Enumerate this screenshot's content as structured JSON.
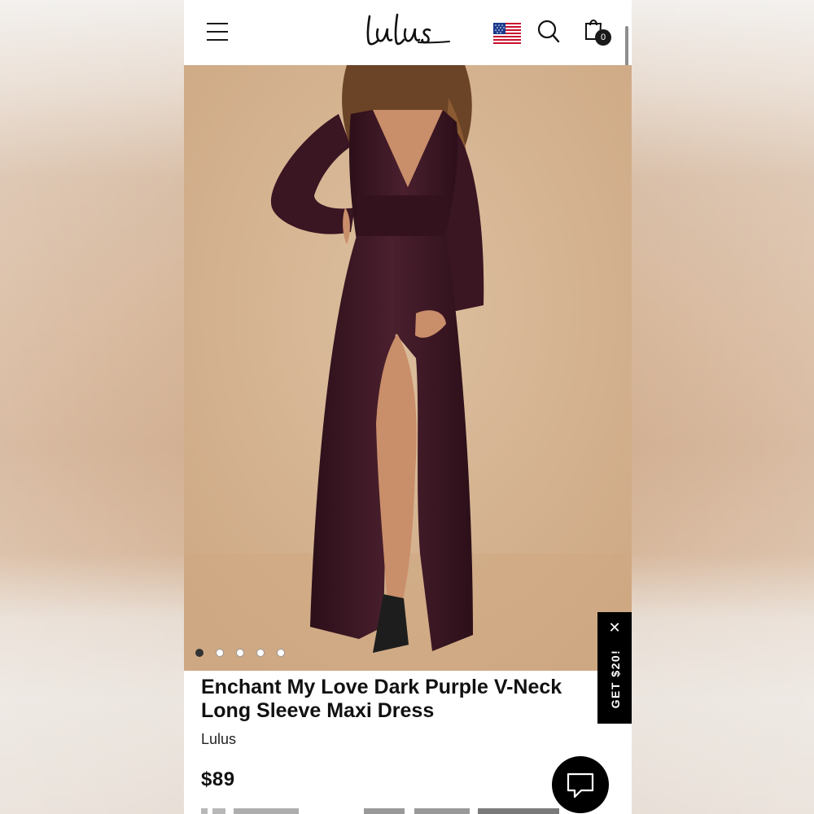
{
  "header": {
    "menu_icon": "hamburger-menu-icon",
    "logo_text": "Lulus",
    "flag_icon": "us-flag-icon",
    "search_icon": "search-icon",
    "cart_icon": "shopping-bag-icon",
    "cart_count": "0"
  },
  "gallery": {
    "image": "dark-purple-long-sleeve-maxi-dress-photo",
    "dots_total": 5,
    "active_dot": 1
  },
  "promo": {
    "label": "GET $20!",
    "close_icon": "close-icon"
  },
  "product": {
    "title": "Enchant My Love Dark Purple V-Neck Long Sleeve Maxi Dress",
    "brand": "Lulus",
    "price": "$89"
  },
  "chat": {
    "icon": "chat-bubble-icon"
  },
  "colors": {
    "dress": "#3d1a26",
    "backdrop": "#d6b48f",
    "brand_black": "#111111"
  }
}
